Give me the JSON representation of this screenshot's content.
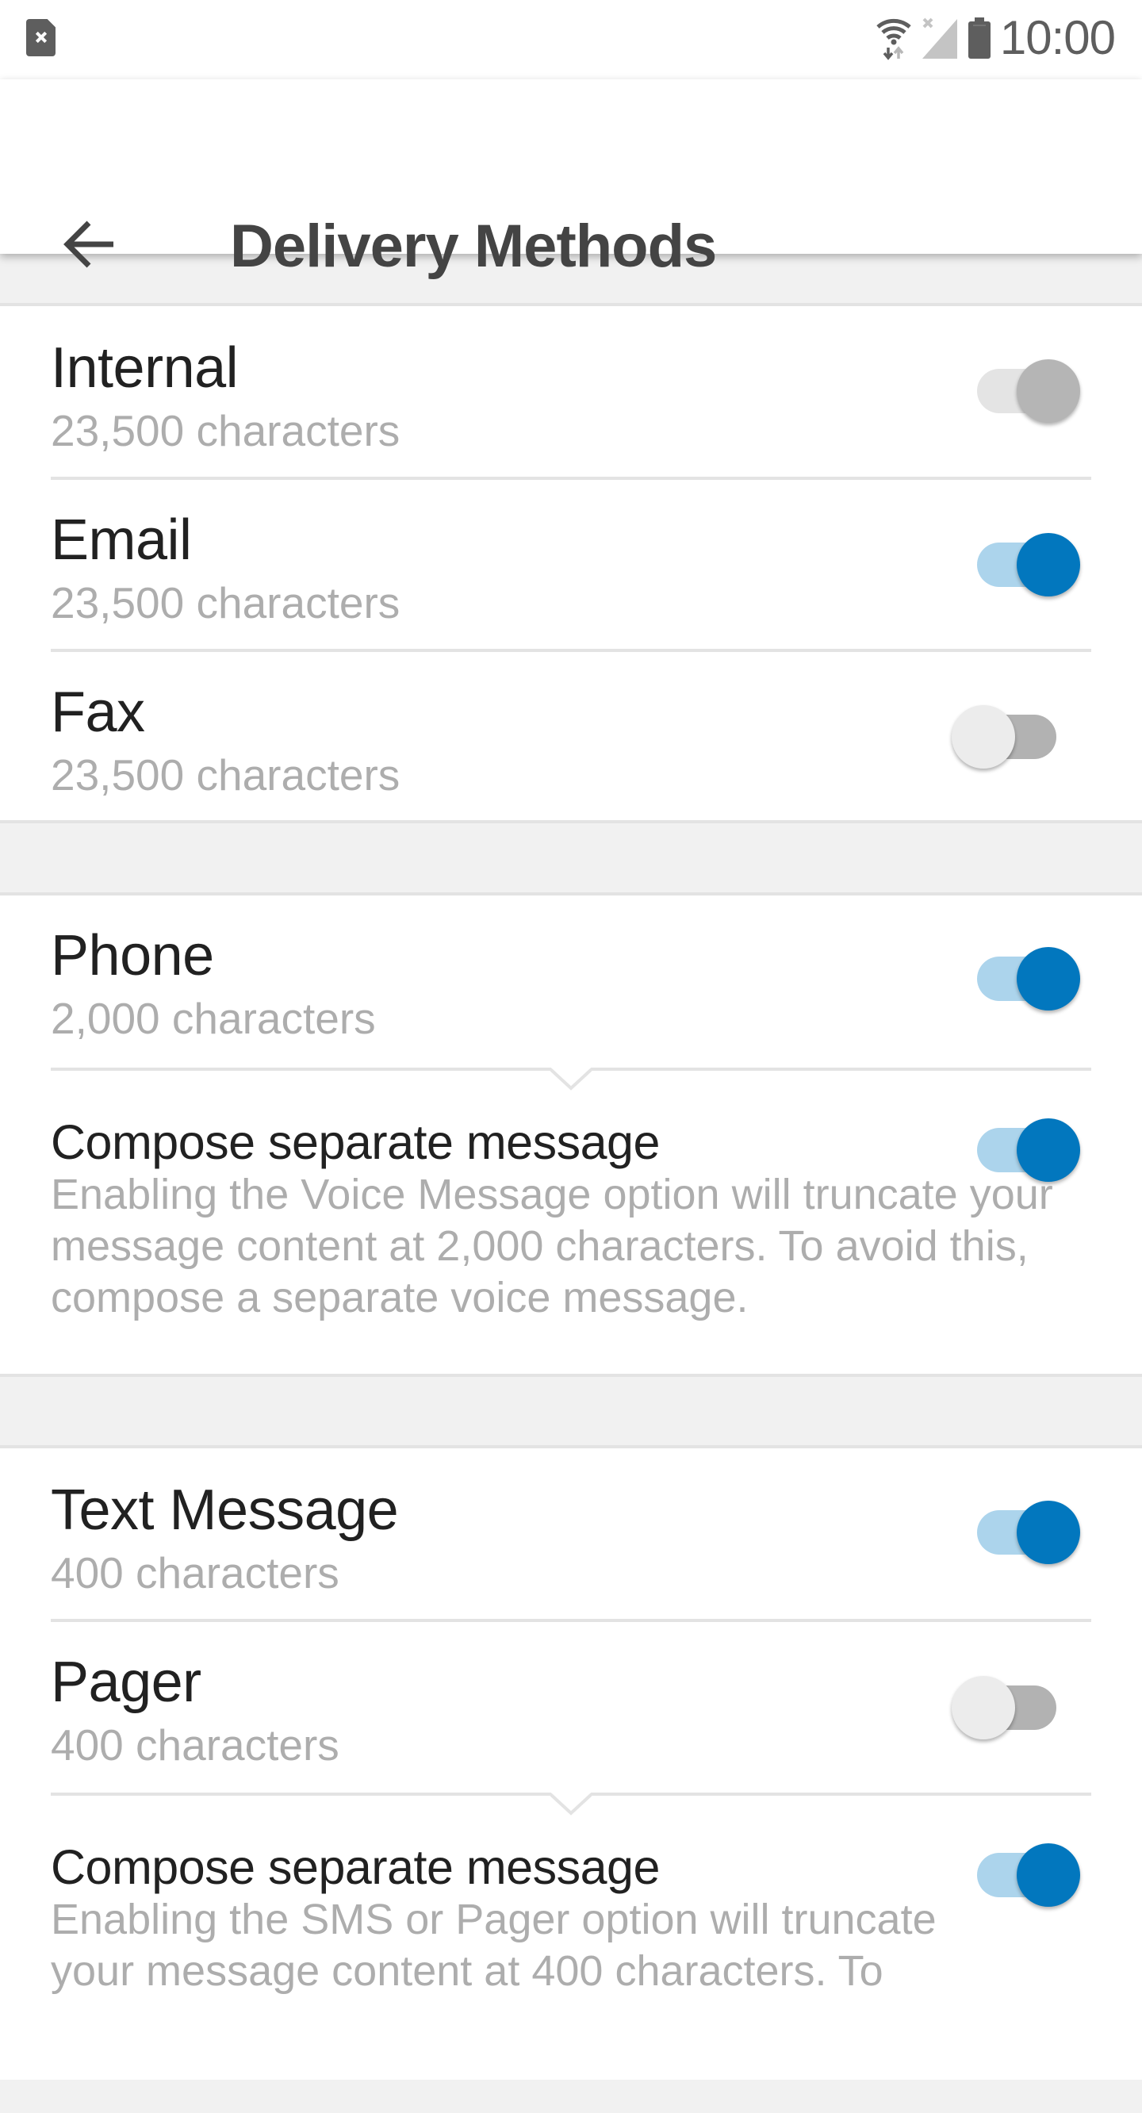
{
  "status_bar": {
    "time": "10:00",
    "icons": [
      "sim-card-missing-icon",
      "wifi-icon",
      "no-signal-icon",
      "battery-icon"
    ]
  },
  "app_bar": {
    "back_icon": "arrow-back-icon",
    "title": "Delivery Methods"
  },
  "colors": {
    "accent": "#0277be",
    "accent_track": "#acd4ec",
    "section_gap": "#f1f1f1",
    "divider": "#e3e3e3",
    "title_text": "#212121",
    "secondary_text": "#adadad"
  },
  "sections": [
    {
      "items": [
        {
          "title": "Internal",
          "subtitle": "23,500 characters",
          "toggle": "on",
          "enabled": false
        },
        {
          "title": "Email",
          "subtitle": "23,500 characters",
          "toggle": "on",
          "enabled": true
        },
        {
          "title": "Fax",
          "subtitle": "23,500 characters",
          "toggle": "off",
          "enabled": true
        }
      ]
    },
    {
      "items": [
        {
          "title": "Phone",
          "subtitle": "2,000 characters",
          "toggle": "on",
          "enabled": true
        }
      ],
      "compose": {
        "title": "Compose separate message",
        "description": "Enabling the Voice Message option will truncate your message content at 2,000 characters. To avoid this, compose a separate voice message.",
        "toggle": "on"
      }
    },
    {
      "items": [
        {
          "title": "Text Message",
          "subtitle": "400 characters",
          "toggle": "on",
          "enabled": true
        },
        {
          "title": "Pager",
          "subtitle": "400 characters",
          "toggle": "off",
          "enabled": true
        }
      ],
      "compose": {
        "title": "Compose separate message",
        "description": "Enabling the SMS or Pager option will truncate your message content at 400 characters. To",
        "toggle": "on"
      }
    }
  ]
}
